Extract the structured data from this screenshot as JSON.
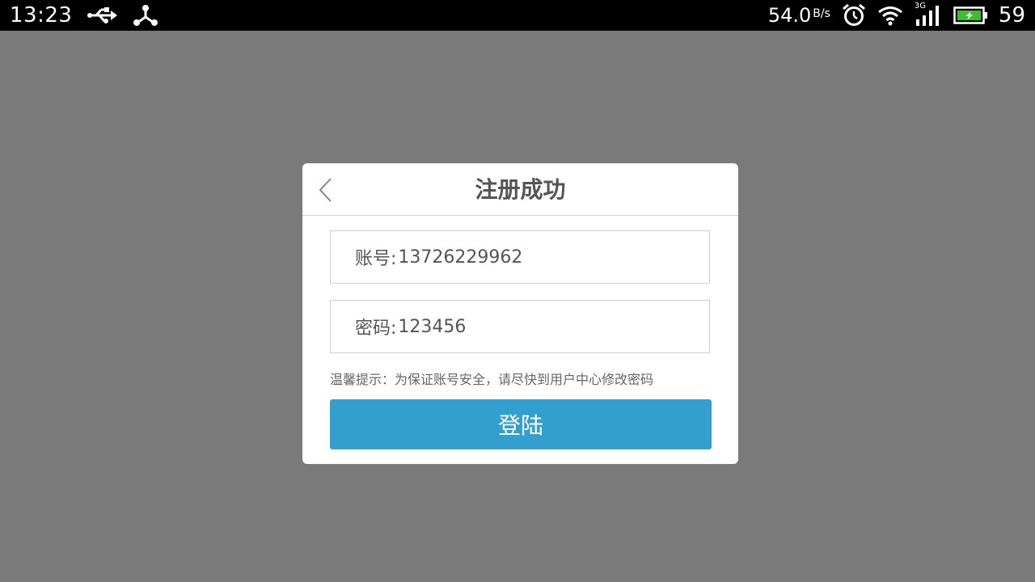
{
  "status_bar": {
    "time": "13:23",
    "speed_value": "54.0",
    "speed_unit": "B/s",
    "battery_level": "59",
    "icons": [
      "usb-icon",
      "share-icon",
      "alarm-icon",
      "wifi-icon",
      "signal-3g-icon",
      "battery-icon"
    ],
    "network_type": "3G"
  },
  "dialog": {
    "title": "注册成功",
    "account_label": "账号:",
    "account_value": "13726229962",
    "password_label": "密码:",
    "password_value": "123456",
    "tip": "温馨提示：为保证账号安全，请尽快到用户中心修改密码",
    "login_label": "登陆"
  },
  "colors": {
    "overlay": "#7a7a7a",
    "accent": "#329fcf"
  }
}
